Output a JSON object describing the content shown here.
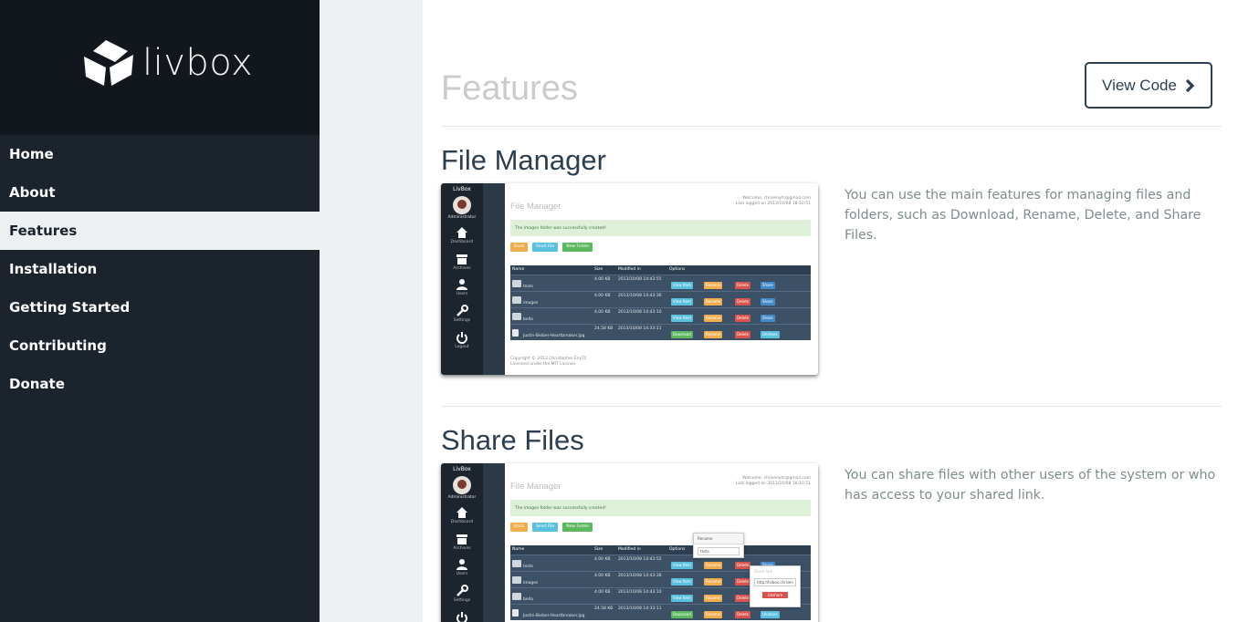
{
  "brand": {
    "name": "livbox",
    "logo_icon": "cube-icon"
  },
  "nav": {
    "items": [
      {
        "label": "Home",
        "active": false
      },
      {
        "label": "About",
        "active": false
      },
      {
        "label": "Features",
        "active": true
      },
      {
        "label": "Installation",
        "active": false
      },
      {
        "label": "Getting Started",
        "active": false
      },
      {
        "label": "Contributing",
        "active": false
      },
      {
        "label": "Donate",
        "active": false
      }
    ]
  },
  "header": {
    "title": "Features",
    "view_code_label": "View Code",
    "view_code_icon": "chevron-right-icon"
  },
  "sections": [
    {
      "title": "File Manager",
      "description": "You can use the main features for managing files and folders, such as Download, Rename, Delete, and Share Files."
    },
    {
      "title": "Share Files",
      "description": "You can share files with other users of the system or who has access to your shared link."
    }
  ],
  "screenshot": {
    "brand": "LivBox",
    "role": "Administrator",
    "nav": [
      "Dashboard",
      "Archives",
      "Users",
      "Settings",
      "Logout"
    ],
    "title": "File Manager",
    "welcome_line1": "Welcome, chrisenytc@gmail.com",
    "welcome_line2": "Last logged on 2013/10/08 18:10:51",
    "alert": "The images folder was successfully created!",
    "buttons": [
      "Back",
      "Send File",
      "New Folder"
    ],
    "columns": [
      "Name",
      "Size",
      "Modified in",
      "Options"
    ],
    "rows": [
      {
        "name": "tests",
        "size": "4.00 KB",
        "modified": "2013/10/08 14:43:55",
        "first_option": "View Item"
      },
      {
        "name": "images",
        "size": "4.00 KB",
        "modified": "2013/10/08 14:43:36",
        "first_option": "View Item"
      },
      {
        "name": "bella",
        "size": "4.00 KB",
        "modified": "2013/10/08 14:43:10",
        "first_option": "View Item"
      },
      {
        "name": "Justin-Bieber-Heartbreaker.jpg",
        "size": "24.58 KB",
        "modified": "2013/10/08 14:33:11",
        "first_option": "Download"
      }
    ],
    "options": [
      "Rename",
      "Delete",
      "Share"
    ],
    "last_share_label": "Unshare",
    "footer_line1": "Copyright © 2013 Christopher EnyTC",
    "footer_line2": "Licensed under the MIT License",
    "rename_popover_title": "Rename",
    "rename_popover_value": "tests",
    "share_popover_title": "Share link",
    "share_popover_value": "http://livbox.chrisen",
    "share_popover_button": "Unshare"
  },
  "colors": {
    "sidebar": "#1b232c",
    "logo_bg": "#12171d",
    "active_bg": "#ecf0f1",
    "heading": "#2c3e50",
    "muted_title": "#c9cbcd",
    "text": "#7f8c8d"
  }
}
